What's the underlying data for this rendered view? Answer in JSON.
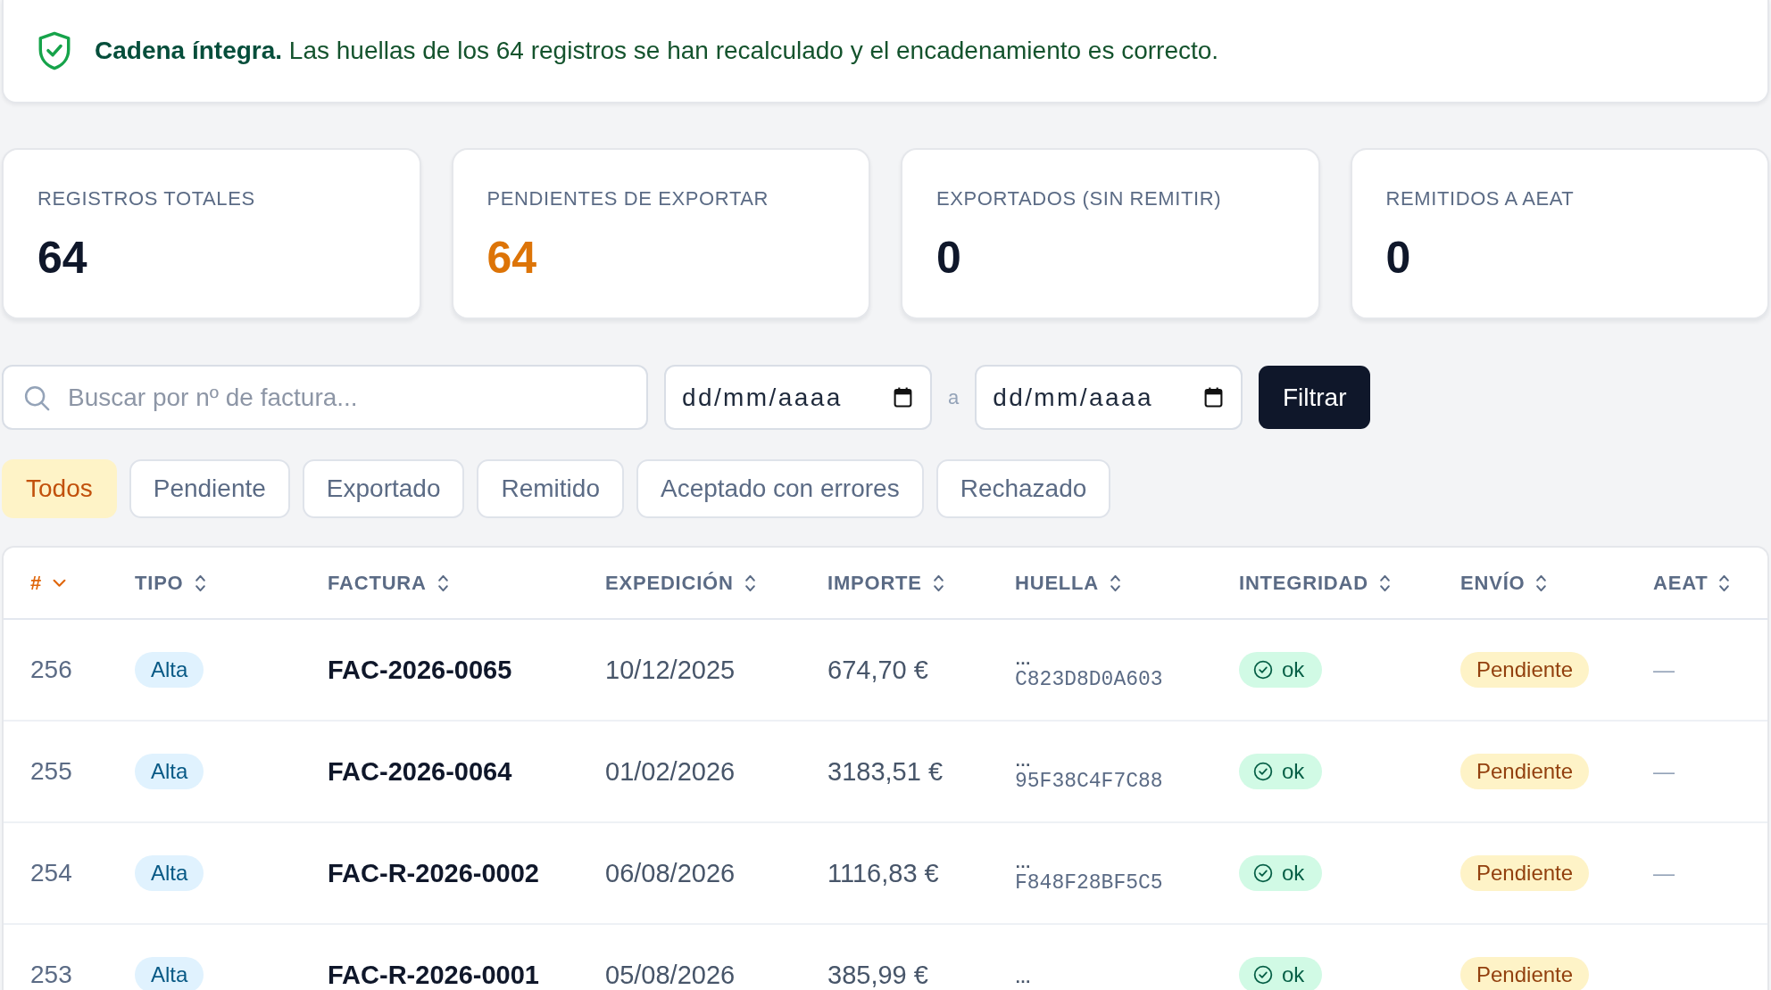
{
  "banner": {
    "kind": "ok",
    "text": "**Cadena íntegra.** Las huellas de los 64 registros se han recalculado y el encadenamiento es correcto."
  },
  "stats": [
    {
      "label": "REGISTROS TOTALES",
      "value": "64",
      "kind": "normal"
    },
    {
      "label": "PENDIENTES DE EXPORTAR",
      "value": "64",
      "kind": "warning"
    },
    {
      "label": "EXPORTADOS (SIN REMITIR)",
      "value": "0",
      "kind": "normal"
    },
    {
      "label": "REMITIDOS A AEAT",
      "value": "0",
      "kind": "normal"
    }
  ],
  "filters": {
    "search": {
      "placeholder": "Buscar por nº de factura..."
    },
    "date_from": {
      "placeholder": "dd/mm/aaaa"
    },
    "range_separator": "a",
    "date_to": {
      "placeholder": "dd/mm/aaaa"
    },
    "submit": "Filtrar"
  },
  "status_tabs": [
    {
      "label": "Todos",
      "selected": true
    },
    {
      "label": "Pendiente",
      "selected": false
    },
    {
      "label": "Exportado",
      "selected": false
    },
    {
      "label": "Remitido",
      "selected": false
    },
    {
      "label": "Aceptado con errores",
      "selected": false
    },
    {
      "label": "Rechazado",
      "selected": false
    }
  ],
  "table": {
    "columns": [
      {
        "label": "#",
        "sorted": true
      },
      {
        "label": "TIPO",
        "sorted": false
      },
      {
        "label": "FACTURA",
        "sorted": false
      },
      {
        "label": "EXPEDICIÓN",
        "sorted": false
      },
      {
        "label": "IMPORTE",
        "sorted": false
      },
      {
        "label": "HUELLA",
        "sorted": false
      },
      {
        "label": "INTEGRIDAD",
        "sorted": false
      },
      {
        "label": "ENVÍO",
        "sorted": false
      },
      {
        "label": "AEAT",
        "sorted": false
      }
    ],
    "rows": [
      {
        "number": "256",
        "tipo": {
          "label": "Alta",
          "kind": "alta"
        },
        "factura": "FAC-2026-0065",
        "expedicion": "10/12/2025",
        "importe": "674,70 €",
        "huella": {
          "ellipsis": "…",
          "tail": "C823D8D0A603"
        },
        "integridad": {
          "label": "ok",
          "kind": "ok"
        },
        "envio": {
          "label": "Pendiente",
          "kind": "pending"
        },
        "aeat": "—"
      },
      {
        "number": "255",
        "tipo": {
          "label": "Alta",
          "kind": "alta"
        },
        "factura": "FAC-2026-0064",
        "expedicion": "01/02/2026",
        "importe": "3183,51 €",
        "huella": {
          "ellipsis": "…",
          "tail": "95F38C4F7C88"
        },
        "integridad": {
          "label": "ok",
          "kind": "ok"
        },
        "envio": {
          "label": "Pendiente",
          "kind": "pending"
        },
        "aeat": "—"
      },
      {
        "number": "254",
        "tipo": {
          "label": "Alta",
          "kind": "alta"
        },
        "factura": "FAC-R-2026-0002",
        "expedicion": "06/08/2026",
        "importe": "1116,83 €",
        "huella": {
          "ellipsis": "…",
          "tail": "F848F28BF5C5"
        },
        "integridad": {
          "label": "ok",
          "kind": "ok"
        },
        "envio": {
          "label": "Pendiente",
          "kind": "pending"
        },
        "aeat": "—"
      },
      {
        "number": "253",
        "tipo": {
          "label": "Alta",
          "kind": "alta"
        },
        "factura": "FAC-R-2026-0001",
        "expedicion": "05/08/2026",
        "importe": "385,99 €",
        "huella": {
          "ellipsis": "…"
        },
        "integridad": {
          "label": "ok",
          "kind": "ok"
        },
        "envio": {
          "label": "Pendiente",
          "kind": "pending"
        }
      }
    ]
  }
}
